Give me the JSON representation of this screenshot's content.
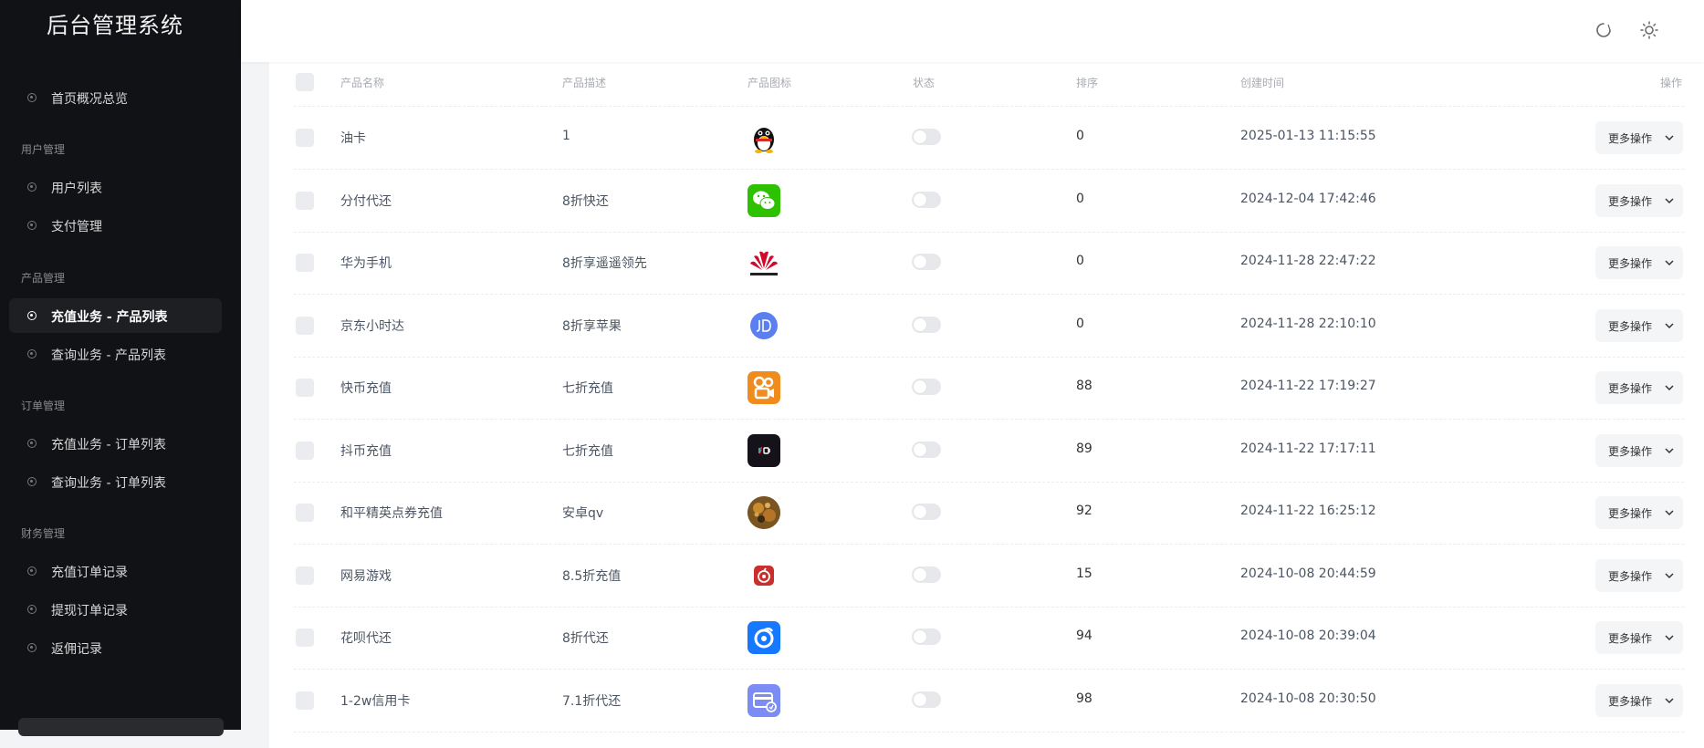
{
  "app": {
    "title": "后台管理系统"
  },
  "sidebar": {
    "groups": {
      "user": "用户管理",
      "product": "产品管理",
      "order": "订单管理",
      "finance": "财务管理"
    },
    "items": [
      {
        "label": "首页概况总览"
      },
      {
        "label": "用户列表"
      },
      {
        "label": "支付管理"
      },
      {
        "label": "充值业务 - 产品列表"
      },
      {
        "label": "查询业务 - 产品列表"
      },
      {
        "label": "充值业务 - 订单列表"
      },
      {
        "label": "查询业务 - 订单列表"
      },
      {
        "label": "充值订单记录"
      },
      {
        "label": "提现订单记录"
      },
      {
        "label": "返佣记录"
      }
    ],
    "active_index": 3
  },
  "header": {
    "avatar_alt": "user"
  },
  "table": {
    "headers": {
      "name": "产品名称",
      "desc": "产品描述",
      "icon": "产品图标",
      "status": "状态",
      "sort": "排序",
      "created": "创建时间",
      "actions": "操作"
    },
    "more_label": "更多操作",
    "rows": [
      {
        "name": "油卡",
        "desc": "1",
        "icon": "qq-penguin-icon",
        "sort": "0",
        "created": "2025-01-13 11:15:55"
      },
      {
        "name": "分付代还",
        "desc": "8折快还",
        "icon": "wechat-icon",
        "sort": "0",
        "created": "2024-12-04 17:42:46"
      },
      {
        "name": "华为手机",
        "desc": "8折享遥遥领先",
        "icon": "huawei-icon",
        "sort": "0",
        "created": "2024-11-28 22:47:22"
      },
      {
        "name": "京东小时达",
        "desc": "8折享苹果",
        "icon": "jd-icon",
        "sort": "0",
        "created": "2024-11-28 22:10:10"
      },
      {
        "name": "快币充值",
        "desc": "七折充值",
        "icon": "kuaishou-icon",
        "sort": "88",
        "created": "2024-11-22 17:19:27"
      },
      {
        "name": "抖币充值",
        "desc": "七折充值",
        "icon": "douyin-icon",
        "sort": "89",
        "created": "2024-11-22 17:17:11"
      },
      {
        "name": "和平精英点券充值",
        "desc": "安卓qv",
        "icon": "game-character-icon",
        "sort": "92",
        "created": "2024-11-22 16:25:12"
      },
      {
        "name": "网易游戏",
        "desc": "8.5折充值",
        "icon": "netease-icon",
        "sort": "15",
        "created": "2024-10-08 20:44:59"
      },
      {
        "name": "花呗代还",
        "desc": "8折代还",
        "icon": "huabei-icon",
        "sort": "94",
        "created": "2024-10-08 20:39:04"
      },
      {
        "name": "1-2w信用卡",
        "desc": "7.1折代还",
        "icon": "credit-card-icon",
        "sort": "98",
        "created": "2024-10-08 20:30:50"
      }
    ]
  },
  "colors": {
    "sidebar_bg": "#111215",
    "wechat": "#2dc100",
    "huawei": "#cf0a2c",
    "jd": "#5b7ff0",
    "kuaishou": "#f08b1e",
    "netease": "#c9302c",
    "huabei": "#1677ff",
    "credit_card": "#7b8cf5"
  }
}
